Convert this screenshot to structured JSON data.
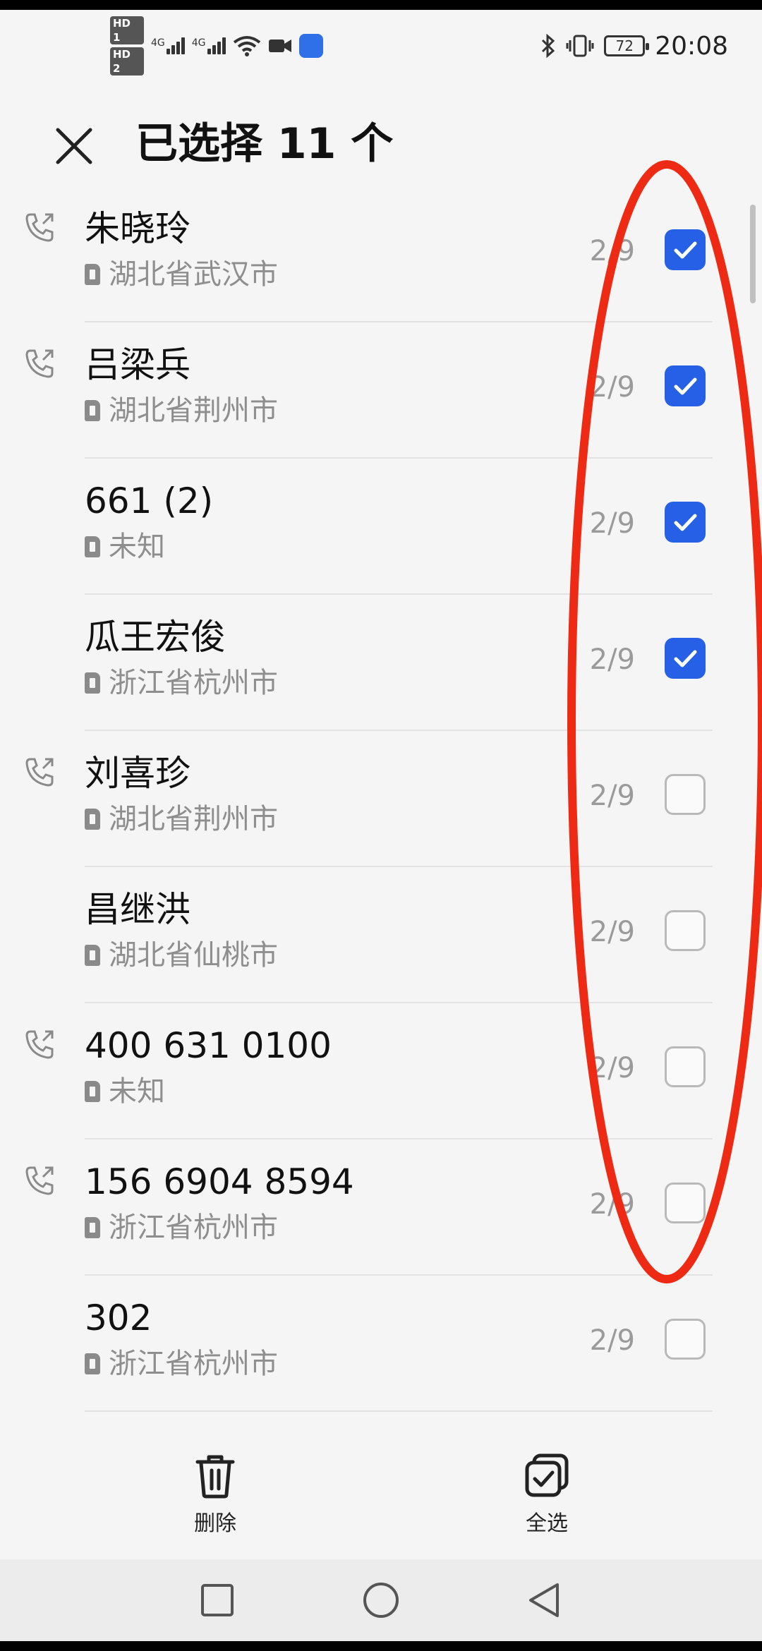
{
  "status_bar": {
    "left_icons": [
      "hd1-icon",
      "hd2-icon",
      "signal-4g-icon",
      "signal-4g-icon",
      "wifi-icon",
      "video-icon",
      "shield-icon"
    ],
    "network_labels": [
      "4G",
      "4G"
    ],
    "hd_labels": [
      "HD 1",
      "HD 2"
    ],
    "bluetooth_icon": "bluetooth-icon",
    "vibrate_icon": "vibrate-icon",
    "battery": "72",
    "time": "20:08"
  },
  "header": {
    "close_icon": "close-icon",
    "title": "已选择 11 个"
  },
  "contacts": [
    {
      "name": "朱晓玲",
      "location": "湖北省武汉市",
      "count": "2/9",
      "checked": true,
      "has_call_icon": true
    },
    {
      "name": "吕梁兵",
      "location": "湖北省荆州市",
      "count": "2/9",
      "checked": true,
      "has_call_icon": true
    },
    {
      "name": "661 (2)",
      "location": "未知",
      "count": "2/9",
      "checked": true,
      "has_call_icon": false
    },
    {
      "name": "瓜王宏俊",
      "location": "浙江省杭州市",
      "count": "2/9",
      "checked": true,
      "has_call_icon": false
    },
    {
      "name": "刘喜珍",
      "location": "湖北省荆州市",
      "count": "2/9",
      "checked": false,
      "has_call_icon": true
    },
    {
      "name": "昌继洪",
      "location": "湖北省仙桃市",
      "count": "2/9",
      "checked": false,
      "has_call_icon": false
    },
    {
      "name": "400 631 0100",
      "location": "未知",
      "count": "2/9",
      "checked": false,
      "has_call_icon": true
    },
    {
      "name": "156 6904 8594",
      "location": "浙江省杭州市",
      "count": "2/9",
      "checked": false,
      "has_call_icon": true
    },
    {
      "name": "302",
      "location": "浙江省杭州市",
      "count": "2/9",
      "checked": false,
      "has_call_icon": false
    }
  ],
  "actions": {
    "delete_label": "删除",
    "select_all_label": "全选"
  },
  "colors": {
    "accent": "#2560e6",
    "annotation": "#ee2a14",
    "background": "#f5f5f5"
  }
}
